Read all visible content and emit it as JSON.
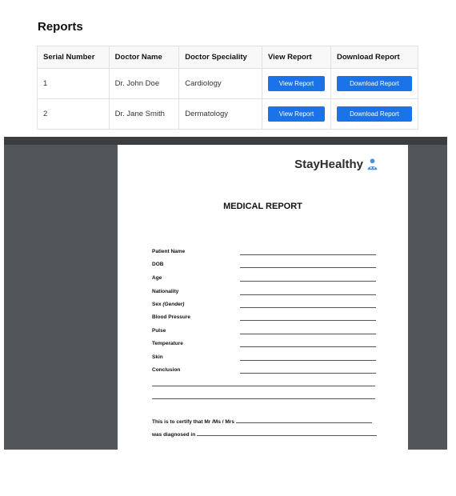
{
  "page": {
    "title": "Reports"
  },
  "table": {
    "headers": [
      "Serial Number",
      "Doctor Name",
      "Doctor Speciality",
      "View Report",
      "Download Report"
    ],
    "rows": [
      {
        "serial": "1",
        "doctor": "Dr. John Doe",
        "speciality": "Cardiology",
        "view_label": "View Report",
        "download_label": "Download Report"
      },
      {
        "serial": "2",
        "doctor": "Dr. Jane Smith",
        "speciality": "Dermatology",
        "view_label": "View Report",
        "download_label": "Download Report"
      }
    ]
  },
  "pdf": {
    "brand": "StayHealthy",
    "brand_icon": "doctor-person-icon",
    "title": "MEDICAL REPORT",
    "fields": [
      {
        "label": "Patient Name"
      },
      {
        "label": "DOB"
      },
      {
        "label": "Age"
      },
      {
        "label": "Nationality"
      },
      {
        "label": "Sex",
        "sub": "(Gender)"
      },
      {
        "label": "Blood Pressure"
      },
      {
        "label": "Pulse"
      },
      {
        "label": "Temperature"
      },
      {
        "label": "Skin"
      },
      {
        "label": "Conclusion"
      }
    ],
    "certify_text": "This is to certify that Mr /Ms / Mrs",
    "diagnosed_text": "was diagnosed in"
  },
  "colors": {
    "button": "#1a73e8",
    "viewer_bg": "#525659",
    "brand_icon": "#4a90d9"
  }
}
